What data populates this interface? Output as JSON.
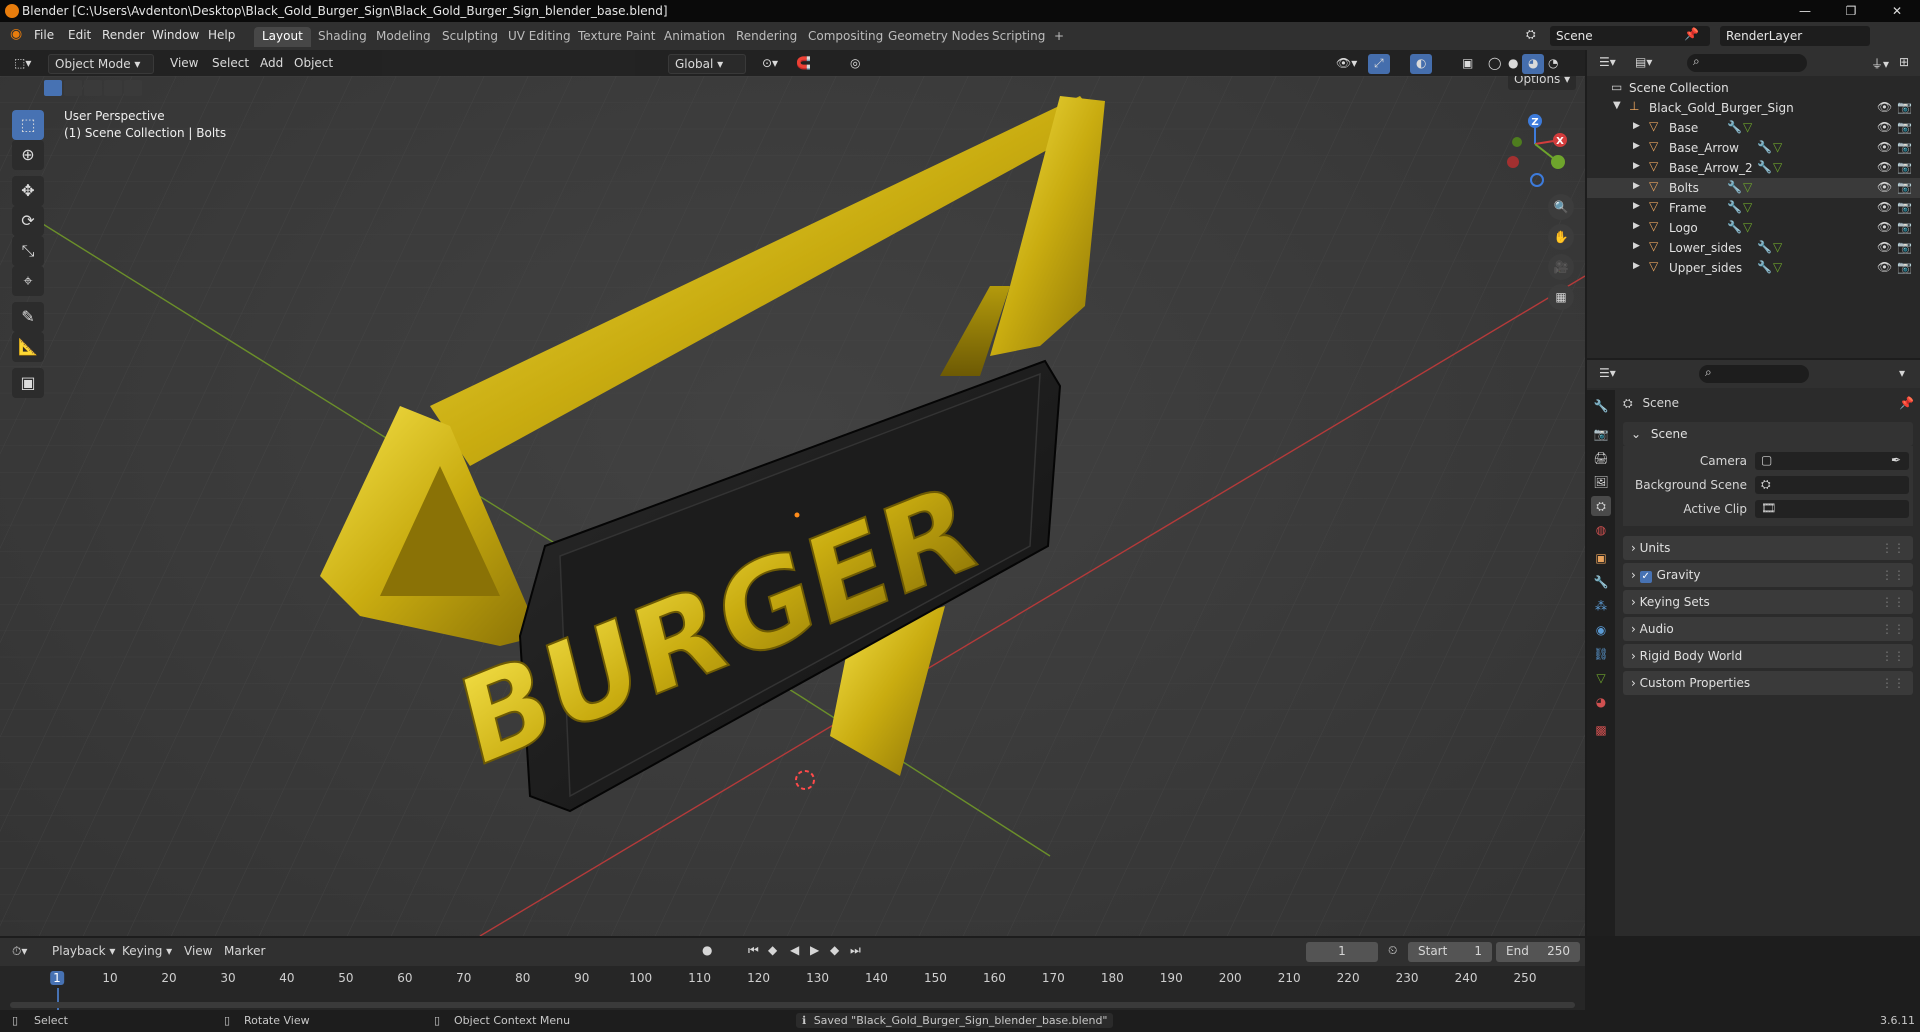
{
  "window": {
    "title": "Blender [C:\\Users\\Avdenton\\Desktop\\Black_Gold_Burger_Sign\\Black_Gold_Burger_Sign_blender_base.blend]",
    "minimize": "—",
    "maximize": "❐",
    "close": "✕"
  },
  "menubar": {
    "menus": [
      "File",
      "Edit",
      "Render",
      "Window",
      "Help"
    ],
    "workspaces": [
      "Layout",
      "Shading",
      "Modeling",
      "Sculpting",
      "UV Editing",
      "Texture Paint",
      "Animation",
      "Rendering",
      "Compositing",
      "Geometry Nodes",
      "Scripting"
    ],
    "active_workspace": "Layout",
    "add_tab": "+",
    "scene_name": "Scene",
    "render_layer": "RenderLayer"
  },
  "viewport_header": {
    "mode": "Object Mode",
    "menus": [
      "View",
      "Select",
      "Add",
      "Object"
    ],
    "orientation": "Global",
    "options": "Options"
  },
  "viewport": {
    "view_name": "User Perspective",
    "view_context": "(1) Scene Collection | Bolts",
    "sign_text": "BURGER",
    "gizmo_axes": [
      "Z",
      "X",
      "Y"
    ]
  },
  "outliner": {
    "root": "Scene Collection",
    "collection": "Black_Gold_Burger_Sign",
    "objects": [
      "Base",
      "Base_Arrow",
      "Base_Arrow_2",
      "Bolts",
      "Frame",
      "Logo",
      "Lower_sides",
      "Upper_sides"
    ],
    "active_object": "Bolts"
  },
  "properties": {
    "context": "Scene",
    "section": "Scene",
    "fields": [
      {
        "label": "Camera",
        "value": ""
      },
      {
        "label": "Background Scene",
        "value": ""
      },
      {
        "label": "Active Clip",
        "value": ""
      }
    ],
    "panels": [
      "Units",
      "Gravity",
      "Keying Sets",
      "Audio",
      "Rigid Body World",
      "Custom Properties"
    ],
    "gravity_checked": true
  },
  "timeline": {
    "menus": [
      "Playback",
      "Keying",
      "View",
      "Marker"
    ],
    "current_frame": "1",
    "start_label": "Start",
    "start": "1",
    "end_label": "End",
    "end": "250",
    "ticks": [
      "1",
      "10",
      "20",
      "30",
      "40",
      "50",
      "60",
      "70",
      "80",
      "90",
      "100",
      "110",
      "120",
      "130",
      "140",
      "150",
      "160",
      "170",
      "180",
      "190",
      "200",
      "210",
      "220",
      "230",
      "240",
      "250"
    ]
  },
  "statusbar": {
    "select": "Select",
    "rotate": "Rotate View",
    "context_menu": "Object Context Menu",
    "message": "Saved \"Black_Gold_Burger_Sign_blender_base.blend\"",
    "version": "3.6.11"
  },
  "colors": {
    "accent": "#4772b3",
    "gold": "#d9c21a",
    "sign_black": "#1a1a1a",
    "object_icon": "#e8a35d"
  }
}
